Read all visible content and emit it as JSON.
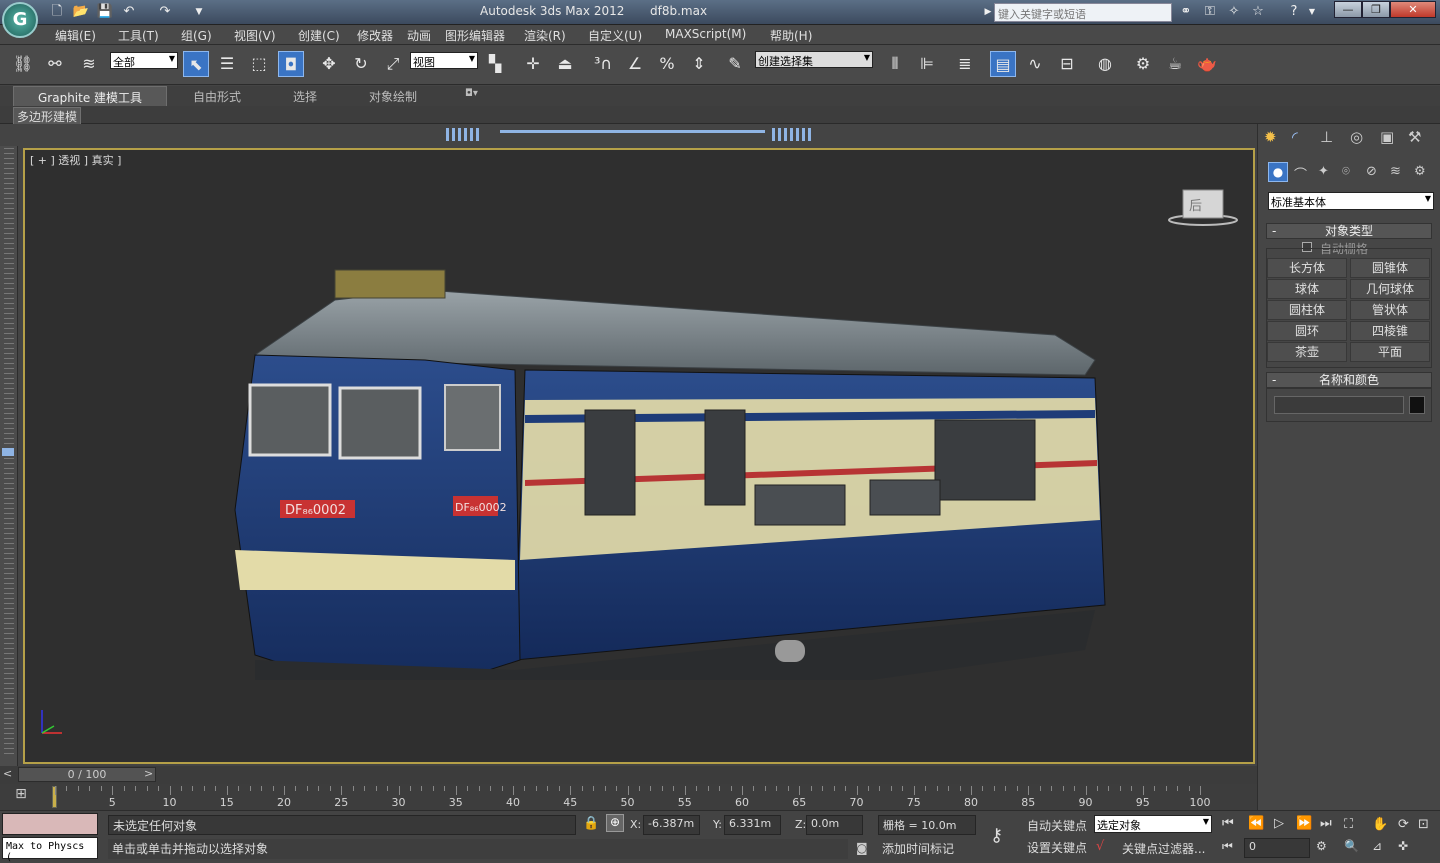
{
  "window": {
    "app_title": "Autodesk 3ds Max  2012",
    "file_name": "df8b.max",
    "search_placeholder": "键入关键字或短语",
    "minimize": "—",
    "restore": "❐",
    "close": "✕"
  },
  "quick_access": [
    "new-icon",
    "open-icon",
    "save-icon",
    "undo-icon",
    "redo-icon"
  ],
  "menu": [
    "编辑(E)",
    "工具(T)",
    "组(G)",
    "视图(V)",
    "创建(C)",
    "修改器",
    "动画",
    "图形编辑器",
    "渲染(R)",
    "自定义(U)",
    "MAXScript(M)",
    "帮助(H)"
  ],
  "toolbar": {
    "selection_filter": "全部",
    "ref_coord": "视图",
    "named_selection": "创建选择集"
  },
  "ribbon": {
    "tabs": [
      "Graphite 建模工具",
      "自由形式",
      "选择",
      "对象绘制"
    ],
    "sub_label": "多边形建模"
  },
  "viewport": {
    "label": "[ + ] 透视 ] 真实 ]",
    "plate_left": "DF₈₆0002",
    "plate_right": "DF₈₆0002",
    "viewcube_face": "后"
  },
  "timeline": {
    "frame_display": "0 / 100",
    "prev_btn": "<",
    "next_btn": ">",
    "tick_labels": [
      "5",
      "10",
      "15",
      "20",
      "25",
      "30",
      "35",
      "40",
      "45",
      "50",
      "55",
      "60",
      "65",
      "70",
      "75",
      "80",
      "85",
      "90",
      "95",
      "100"
    ]
  },
  "status": {
    "maxscript_listener": "Max to Physcs (",
    "selection_status": "未选定任何对象",
    "prompt": "单击或单击并拖动以选择对象",
    "x_label": "X:",
    "x_value": "-6.387m",
    "y_label": "Y:",
    "y_value": "6.331m",
    "z_label": "Z:",
    "z_value": "0.0m",
    "grid": "栅格 = 10.0m",
    "add_time_tag": "添加时间标记",
    "auto_key": "自动关键点",
    "set_key": "设置关键点",
    "key_mode": "选定对象",
    "key_filters": "关键点过滤器...",
    "current_frame": "0"
  },
  "command_panel": {
    "category": "标准基本体",
    "object_type_title": "对象类型",
    "autogrid": "自动栅格",
    "primitives": [
      "长方体",
      "圆锥体",
      "球体",
      "几何球体",
      "圆柱体",
      "管状体",
      "圆环",
      "四棱锥",
      "茶壶",
      "平面"
    ],
    "name_color_title": "名称和颜色",
    "rollout_sign": "-"
  },
  "colors": {
    "viewport_border": "#b5a048",
    "active_tool": "#3a74c4",
    "locomotive_blue": "#1e3c78",
    "locomotive_cream": "#e3dba8",
    "plate_red": "#c83232"
  }
}
